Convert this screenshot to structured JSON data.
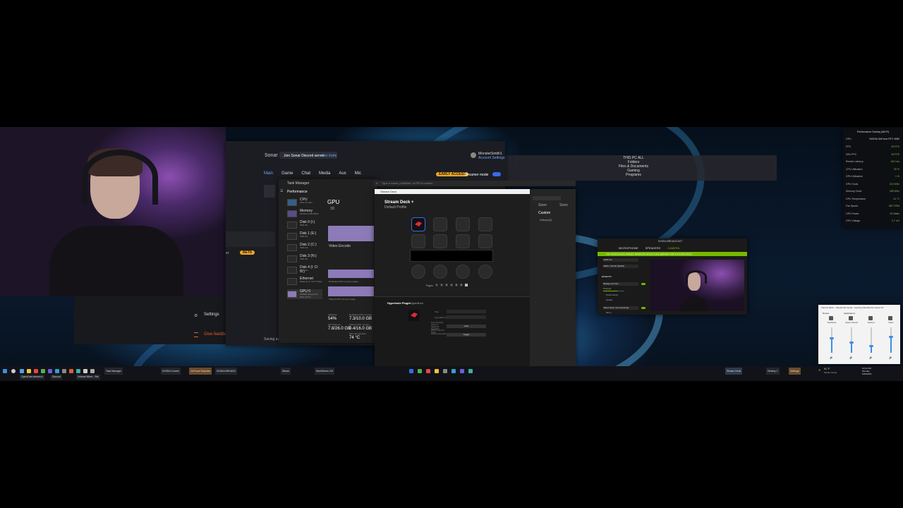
{
  "sonar": {
    "title": "Sonar",
    "discord_banner": "Join Sonar Discord server",
    "discord_link": "Get Invite",
    "account_name": "MonsterSmith1",
    "account_sub": "Account Settings",
    "tabs": [
      "Main",
      "Game",
      "Chat",
      "Media",
      "Aux",
      "Mic"
    ],
    "early_access": "EARLY ACCESS",
    "streamer_mode": "Streamer mode",
    "beta": "BETA",
    "partial_label": "er",
    "settings": "Settings",
    "feedback": "Give feedback",
    "saving": "Saving au"
  },
  "taskmanager": {
    "title": "Task Manager",
    "search_placeholder": "Type a name, publisher, or PID to search",
    "section": "Performance",
    "gpu_title": "GPU",
    "gpu_sub": "3D",
    "items": [
      {
        "name": "CPU",
        "detail": "18% 4.0 GHz"
      },
      {
        "name": "Memory",
        "detail": "18.5/31.9 GB (58%)"
      },
      {
        "name": "Disk 0 (I:)",
        "detail": "SSD 0%"
      },
      {
        "name": "Disk 1 (E:)",
        "detail": "SSD 0%"
      },
      {
        "name": "Disk 2 (C:)",
        "detail": "SSD 1%"
      },
      {
        "name": "Disk 3 (N:)",
        "detail": "SSD 0%"
      },
      {
        "name": "Disk 4 (I: D: G:)",
        "detail": "HDD 0%"
      },
      {
        "name": "Ethernet",
        "detail": "Ethernet S: 0 R: 0 Kbps"
      },
      {
        "name": "GPU 0",
        "detail": "NVIDIA GeForce R 54% (74°C)"
      }
    ],
    "video_encode": "Video Encode",
    "dedicated_usage": "Dedicated GPU memory usage",
    "shared_usage": "Shared GPU memory usage",
    "stats": [
      {
        "label": "Utilization",
        "value": "54%"
      },
      {
        "label": "Dedicated GPU memory",
        "value": "7.3/10.0 GB"
      },
      {
        "label": "GPU Memory",
        "value": "7.8/26.0 GB"
      },
      {
        "label": "Shared GPU memory",
        "value": "0.4/16.0 GB"
      },
      {
        "label": "GPU Temperature",
        "value": "74 °C"
      }
    ]
  },
  "streamdeck": {
    "title": "Stream Deck",
    "device": "Stream Deck +",
    "profile": "Default Profile",
    "pages_label": "Pages",
    "pages": [
      "1",
      "2",
      "3",
      "4",
      "5",
      "6",
      "7"
    ],
    "active_page": "7",
    "side_tabs": [
      "Store",
      "Store"
    ],
    "custom": "Custom",
    "custom_item": "Hotkeys(S)",
    "plugin_header": "Hyperbole Plugin",
    "plugin_name": "HyperBool",
    "form_labels": [
      "Title:",
      "HyperBool ID",
      "Sync this action state to a registered HyperBool",
      "When to use this button",
      "Custom Information"
    ],
    "form_buttons": [
      "Auto",
      "Toggle"
    ]
  },
  "searchpanel": {
    "items": [
      "THIS PC ALL",
      "Folders",
      "Files & Documents",
      "Gaming",
      "Programs"
    ]
  },
  "nvidia": {
    "title": "NVIDIA BROADCAST",
    "tabs": [
      "MICROPHONE",
      "SPEAKERS",
      "CAMERA"
    ],
    "notice": "Your camera source changed. Restart the camera in any application that is currently using it.",
    "source": "C922 Pro",
    "resolution": "1080 x 720 60 (MJPG)",
    "effects_label": "EFFECTS",
    "effect": "Background blur",
    "strength_label": "Strength",
    "modes": [
      "Performance",
      "Quality"
    ],
    "second_effect": "Video Noise removal (beta)",
    "mirror": "Mirror"
  },
  "mixer": {
    "title": "Volume Mixer - Steelseries Sonar - Gaming (SteelSeries Sonar Vir...",
    "device_label": "Device",
    "apps_label": "Applications",
    "channels": [
      {
        "name": "SteelSeries",
        "level": 0.55
      },
      {
        "name": "System Sounds",
        "level": 0.4
      },
      {
        "name": "Destiny 2",
        "level": 0.25
      },
      {
        "name": "Steam",
        "level": 0.6
      }
    ]
  },
  "perf_overlay": {
    "title": "Performance Overlay (Alt+R)",
    "gpu_label": "GPU",
    "gpu_name": "NVIDIA GeForce RTX 3080",
    "rows": [
      {
        "label": "FPS",
        "value": "29 FPS"
      },
      {
        "label": "99% FPS",
        "value": "34 FPS"
      },
      {
        "label": "Render Latency",
        "value": "18.0 ms"
      },
      {
        "label": "CPU Utilization",
        "value": "30 %"
      },
      {
        "label": "GPU Utilization",
        "value": "1 %"
      },
      {
        "label": "GPU Clock",
        "value": "210 MHz"
      },
      {
        "label": "Memory Clock",
        "value": "405 MHz"
      },
      {
        "label": "GPU Temperature",
        "value": "41 °C"
      },
      {
        "label": "Fan Speed",
        "value": "887 RPM"
      },
      {
        "label": "GPU Power",
        "value": "23 Watts"
      },
      {
        "label": "GPU Voltage",
        "value": "0.7 mV"
      }
    ]
  },
  "taskbar": {
    "apps_left": [
      "Task Manager",
      "NVIDIA Control",
      "GeForce Experien",
      "NVIDIA BROADC",
      "Steam",
      "SteelSeries GG"
    ],
    "apps_right": [
      "Stream Deck",
      "Destiny 2",
      "Settings"
    ],
    "second_row": [
      "OpenCam.stream.b",
      "Discord",
      "Volume Mixer - Ste"
    ],
    "weather": "91 °F",
    "weather_sub": "Mostly cloudy",
    "time": "10:21 PM",
    "day": "Monday",
    "date": "6/26/2023"
  },
  "colors": {
    "nvidia_green": "#76b900",
    "sonar_orange": "#f3a623",
    "sonar_accent": "#3a68f0",
    "tm_graph": "#8d7ab8"
  }
}
